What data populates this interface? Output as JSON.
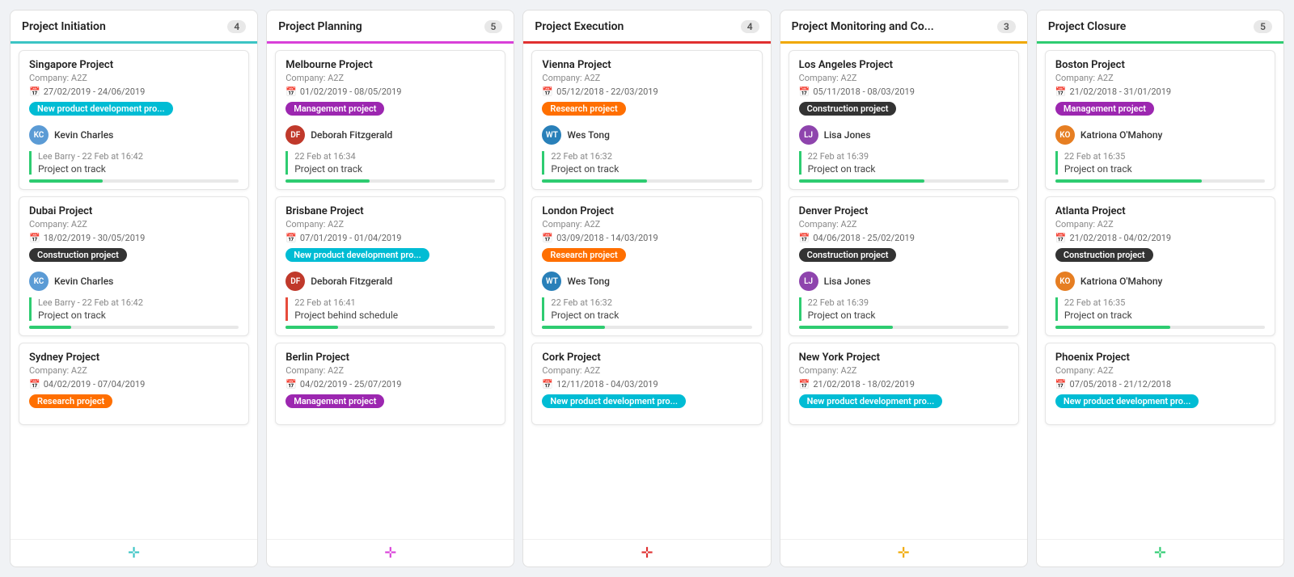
{
  "columns": [
    {
      "id": "col-0",
      "title": "Project Initiation",
      "count": "4",
      "headerColor": "#3bc4c4",
      "addIconColor": "#3bc4c4",
      "cards": [
        {
          "title": "Singapore Project",
          "company": "Company: A2Z",
          "date": "27/02/2019 - 24/06/2019",
          "tagText": "New product development pro...",
          "tagClass": "tag-cyan",
          "personName": "Kevin Charles",
          "avatarClass": "avatar-kc",
          "avatarInitials": "KC",
          "logTime": "Lee Barry - 22 Feb at 16:42",
          "logStatus": "Project on track",
          "logClass": "",
          "progressWidth": "35%"
        },
        {
          "title": "Dubai Project",
          "company": "Company: A2Z",
          "date": "18/02/2019 - 30/05/2019",
          "tagText": "Construction project",
          "tagClass": "tag-dark",
          "personName": "Kevin Charles",
          "avatarClass": "avatar-kc",
          "avatarInitials": "KC",
          "logTime": "Lee Barry - 22 Feb at 16:42",
          "logStatus": "Project on track",
          "logClass": "",
          "progressWidth": "20%"
        },
        {
          "title": "Sydney Project",
          "company": "Company: A2Z",
          "date": "04/02/2019 - 07/04/2019",
          "tagText": "Research project",
          "tagClass": "tag-orange",
          "personName": "",
          "avatarClass": "",
          "avatarInitials": "",
          "logTime": "",
          "logStatus": "",
          "logClass": "",
          "progressWidth": "0%"
        }
      ]
    },
    {
      "id": "col-1",
      "title": "Project Planning",
      "count": "5",
      "headerColor": "#d940d9",
      "addIconColor": "#d940d9",
      "cards": [
        {
          "title": "Melbourne Project",
          "company": "Company: A2Z",
          "date": "01/02/2019 - 08/05/2019",
          "tagText": "Management project",
          "tagClass": "tag-purple",
          "personName": "Deborah Fitzgerald",
          "avatarClass": "avatar-df",
          "avatarInitials": "DF",
          "logTime": "22 Feb at 16:34",
          "logStatus": "Project on track",
          "logClass": "",
          "progressWidth": "40%"
        },
        {
          "title": "Brisbane Project",
          "company": "Company: A2Z",
          "date": "07/01/2019 - 01/04/2019",
          "tagText": "New product development pro...",
          "tagClass": "tag-cyan",
          "personName": "Deborah Fitzgerald",
          "avatarClass": "avatar-df",
          "avatarInitials": "DF",
          "logTime": "22 Feb at 16:41",
          "logStatus": "Project behind schedule",
          "logClass": "red",
          "progressWidth": "25%"
        },
        {
          "title": "Berlin Project",
          "company": "Company: A2Z",
          "date": "04/02/2019 - 25/07/2019",
          "tagText": "Management project",
          "tagClass": "tag-purple",
          "personName": "",
          "avatarClass": "",
          "avatarInitials": "",
          "logTime": "",
          "logStatus": "",
          "logClass": "",
          "progressWidth": "0%"
        }
      ]
    },
    {
      "id": "col-2",
      "title": "Project Execution",
      "count": "4",
      "headerColor": "#e03030",
      "addIconColor": "#e03030",
      "cards": [
        {
          "title": "Vienna Project",
          "company": "Company: A2Z",
          "date": "05/12/2018 - 22/03/2019",
          "tagText": "Research project",
          "tagClass": "tag-orange",
          "personName": "Wes Tong",
          "avatarClass": "avatar-wt",
          "avatarInitials": "WT",
          "logTime": "22 Feb at 16:32",
          "logStatus": "Project on track",
          "logClass": "",
          "progressWidth": "50%"
        },
        {
          "title": "London Project",
          "company": "Company: A2Z",
          "date": "03/09/2018 - 14/03/2019",
          "tagText": "Research project",
          "tagClass": "tag-orange",
          "personName": "Wes Tong",
          "avatarClass": "avatar-wt",
          "avatarInitials": "WT",
          "logTime": "22 Feb at 16:32",
          "logStatus": "Project on track",
          "logClass": "",
          "progressWidth": "30%"
        },
        {
          "title": "Cork Project",
          "company": "Company: A2Z",
          "date": "12/11/2018 - 04/03/2019",
          "tagText": "New product development pro...",
          "tagClass": "tag-cyan",
          "personName": "",
          "avatarClass": "",
          "avatarInitials": "",
          "logTime": "",
          "logStatus": "",
          "logClass": "",
          "progressWidth": "0%"
        }
      ]
    },
    {
      "id": "col-3",
      "title": "Project Monitoring and Co...",
      "count": "3",
      "headerColor": "#f0a800",
      "addIconColor": "#f0a800",
      "cards": [
        {
          "title": "Los Angeles Project",
          "company": "Company: A2Z",
          "date": "05/11/2018 - 08/03/2019",
          "tagText": "Construction project",
          "tagClass": "tag-dark",
          "personName": "Lisa Jones",
          "avatarClass": "avatar-lj",
          "avatarInitials": "LJ",
          "logTime": "22 Feb at 16:39",
          "logStatus": "Project on track",
          "logClass": "",
          "progressWidth": "60%"
        },
        {
          "title": "Denver Project",
          "company": "Company: A2Z",
          "date": "04/06/2018 - 25/02/2019",
          "tagText": "Construction project",
          "tagClass": "tag-dark",
          "personName": "Lisa Jones",
          "avatarClass": "avatar-lj",
          "avatarInitials": "LJ",
          "logTime": "22 Feb at 16:39",
          "logStatus": "Project on track",
          "logClass": "",
          "progressWidth": "45%"
        },
        {
          "title": "New York Project",
          "company": "Company: A2Z",
          "date": "21/02/2018 - 18/02/2019",
          "tagText": "New product development pro...",
          "tagClass": "tag-cyan",
          "personName": "",
          "avatarClass": "",
          "avatarInitials": "",
          "logTime": "",
          "logStatus": "",
          "logClass": "",
          "progressWidth": "0%"
        }
      ]
    },
    {
      "id": "col-4",
      "title": "Project Closure",
      "count": "5",
      "headerColor": "#2ecc71",
      "addIconColor": "#2ecc71",
      "cards": [
        {
          "title": "Boston Project",
          "company": "Company: A2Z",
          "date": "21/02/2018 - 31/01/2019",
          "tagText": "Management project",
          "tagClass": "tag-purple",
          "personName": "Katriona O'Mahony",
          "avatarClass": "avatar-ko",
          "avatarInitials": "KO",
          "logTime": "22 Feb at 16:35",
          "logStatus": "Project on track",
          "logClass": "",
          "progressWidth": "70%"
        },
        {
          "title": "Atlanta Project",
          "company": "Company: A2Z",
          "date": "21/02/2018 - 04/02/2019",
          "tagText": "Construction project",
          "tagClass": "tag-dark",
          "personName": "Katriona O'Mahony",
          "avatarClass": "avatar-ko",
          "avatarInitials": "KO",
          "logTime": "22 Feb at 16:35",
          "logStatus": "Project on track",
          "logClass": "",
          "progressWidth": "55%"
        },
        {
          "title": "Phoenix Project",
          "company": "Company: A2Z",
          "date": "07/05/2018 - 21/12/2018",
          "tagText": "New product development pro...",
          "tagClass": "tag-cyan",
          "personName": "",
          "avatarClass": "",
          "avatarInitials": "",
          "logTime": "",
          "logStatus": "",
          "logClass": "",
          "progressWidth": "0%"
        }
      ]
    }
  ]
}
